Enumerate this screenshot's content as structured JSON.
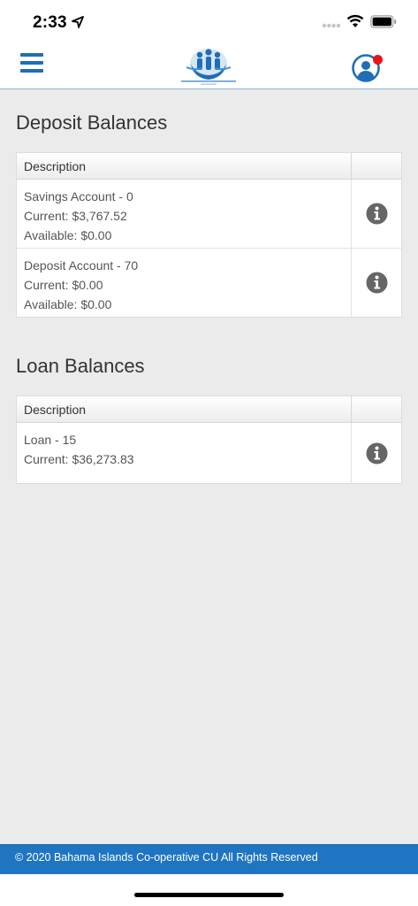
{
  "status_bar": {
    "time": "2:33"
  },
  "header": {
    "brand_color": "#1f6db6",
    "logo_icon": "credit-union-logo",
    "menu_icon": "hamburger-icon",
    "profile_icon": "user-icon"
  },
  "deposit": {
    "title": "Deposit Balances",
    "column_header": "Description",
    "rows": [
      {
        "name": "Savings Account - 0",
        "current": "Current: $3,767.52",
        "available": "Available: $0.00"
      },
      {
        "name": "Deposit Account - 70",
        "current": "Current: $0.00",
        "available": "Available: $0.00"
      }
    ]
  },
  "loan": {
    "title": "Loan Balances",
    "column_header": "Description",
    "rows": [
      {
        "name": "Loan - 15",
        "current": "Current: $36,273.83"
      }
    ]
  },
  "footer": {
    "text": "© 2020 Bahama Islands Co-operative CU All Rights Reserved",
    "color": "#1f75c1"
  }
}
